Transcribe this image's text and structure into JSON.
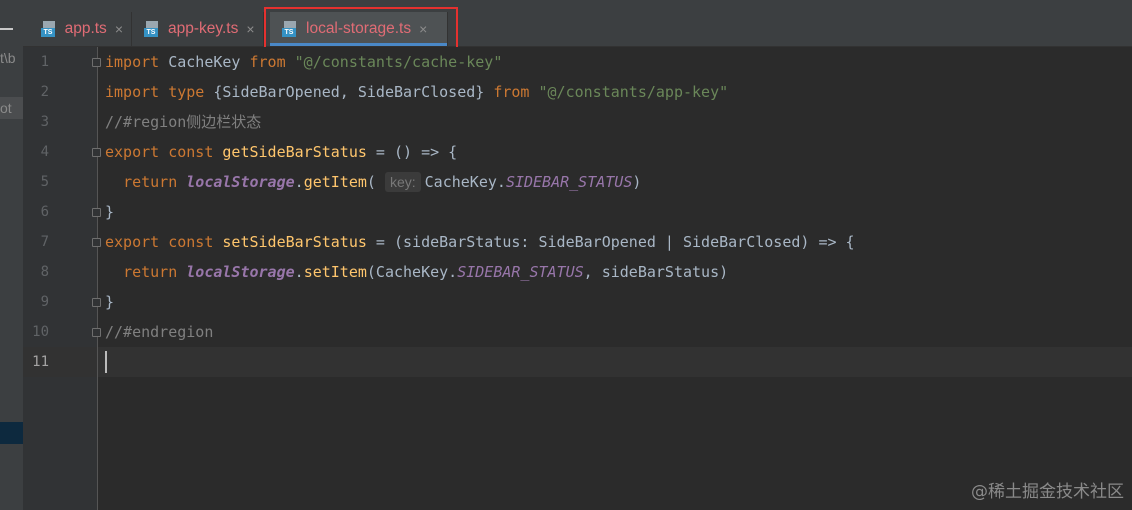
{
  "tabs": [
    {
      "label": "app.ts",
      "icon": "ts-file-icon",
      "active": false
    },
    {
      "label": "app-key.ts",
      "icon": "ts-file-icon",
      "active": false
    },
    {
      "label": "local-storage.ts",
      "icon": "ts-file-icon",
      "active": true
    }
  ],
  "ts_badge": "TS",
  "close_glyph": "×",
  "side": {
    "frag1": "t\\b",
    "frag2": "ot"
  },
  "gutter": {
    "numbers": [
      "1",
      "2",
      "3",
      "4",
      "5",
      "6",
      "7",
      "8",
      "9",
      "10",
      "11"
    ],
    "current": "11"
  },
  "code": {
    "l1": {
      "kw1": "import",
      "t1": " CacheKey ",
      "kw2": "from",
      "sp": " ",
      "str": "\"@/constants/cache-key\""
    },
    "l2": {
      "kw1": "import type",
      "t1": " {SideBarOpened, SideBarClosed} ",
      "kw2": "from",
      "sp": " ",
      "str": "\"@/constants/app-key\""
    },
    "l3": {
      "cmt": "//#region侧边栏状态"
    },
    "l4": {
      "kw1": "export const",
      "sp": " ",
      "fn": "getSideBarStatus",
      "t1": " = () => {"
    },
    "l5": {
      "kw1": "return",
      "sp": " ",
      "glob": "localStorage",
      "t1": ".",
      "fn": "getItem",
      "t2": "(",
      "hint": "key:",
      "t3": "CacheKey.",
      "const": "SIDEBAR_STATUS",
      "t4": ")"
    },
    "l6": {
      "t1": "}"
    },
    "l7": {
      "kw1": "export const",
      "sp": " ",
      "fn": "setSideBarStatus",
      "t1": " = (sideBarStatus: SideBarOpened | SideBarClosed) => {"
    },
    "l8": {
      "kw1": "return",
      "sp": " ",
      "glob": "localStorage",
      "t1": ".",
      "fn": "setItem",
      "t2": "(CacheKey.",
      "const": "SIDEBAR_STATUS",
      "t3": ", sideBarStatus)"
    },
    "l9": {
      "t1": "}"
    },
    "l10": {
      "cmt": "//#endregion"
    }
  },
  "watermark": "@稀土掘金技术社区",
  "colors": {
    "keyword": "#cc7832",
    "string": "#6a8759",
    "comment": "#808080",
    "function": "#ffc66d",
    "global": "#9876aa",
    "tab_label": "#e06c75",
    "highlight_box": "#e5312f"
  }
}
